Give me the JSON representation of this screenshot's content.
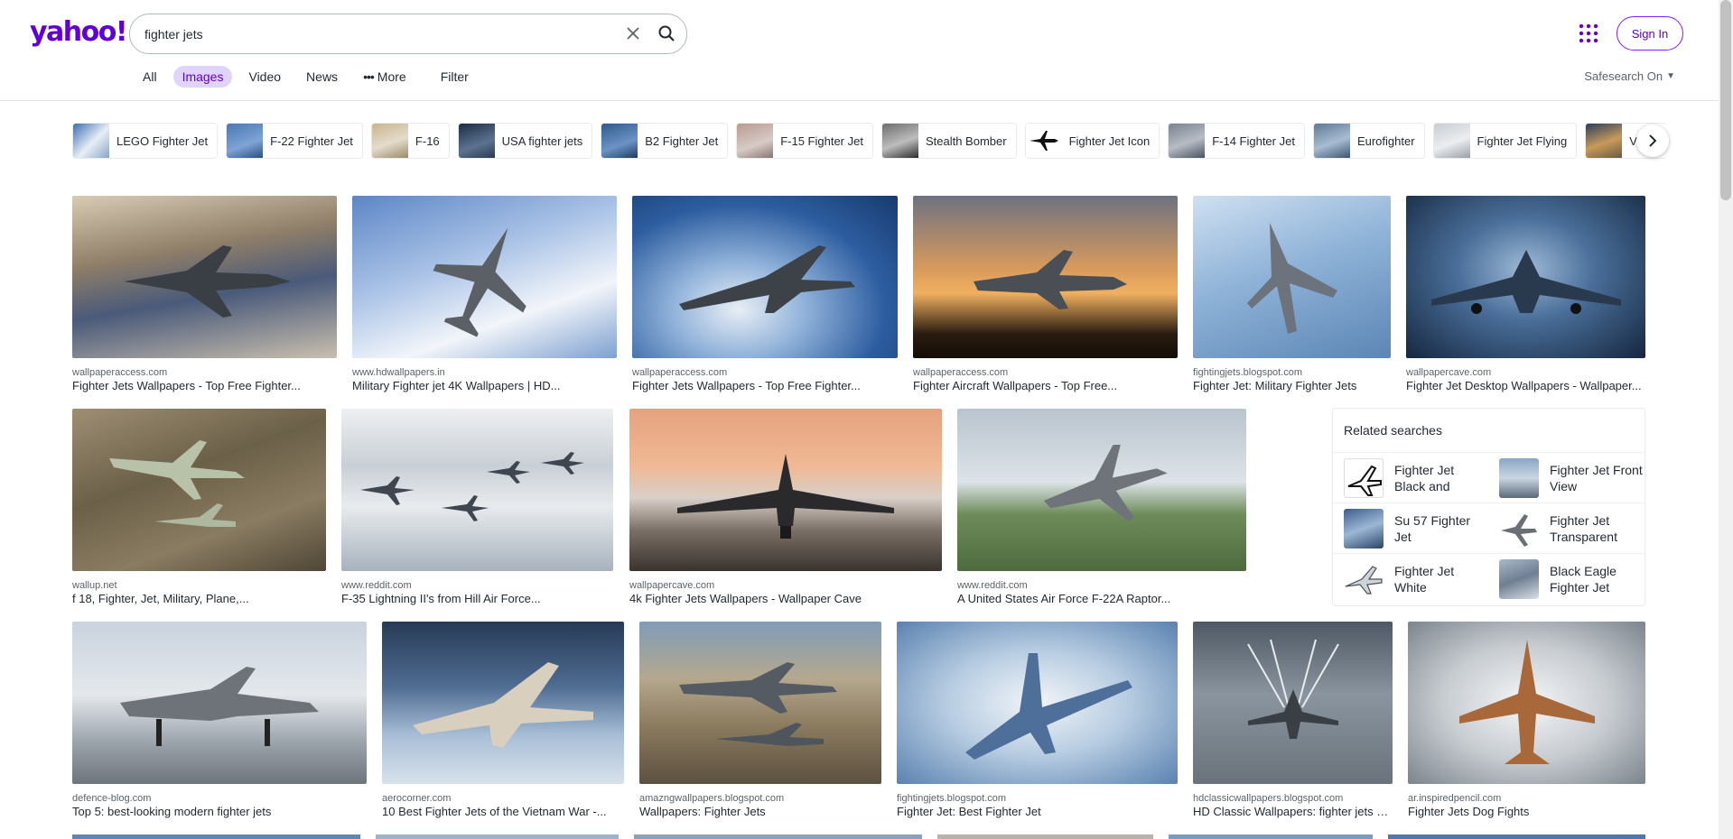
{
  "header": {
    "logo": "yahoo!",
    "search_value": "fighter jets",
    "sign_in": "Sign In",
    "safesearch": "Safesearch On",
    "tabs": [
      {
        "label": "All"
      },
      {
        "label": "Images"
      },
      {
        "label": "Video"
      },
      {
        "label": "News"
      },
      {
        "label": "More"
      },
      {
        "label": "Filter"
      }
    ],
    "active_tab": "Images"
  },
  "pills": [
    {
      "label": "LEGO Fighter Jet"
    },
    {
      "label": "F-22 Fighter Jet"
    },
    {
      "label": "F-16"
    },
    {
      "label": "USA fighter jets"
    },
    {
      "label": "B2 Fighter Jet"
    },
    {
      "label": "F-15 Fighter Jet"
    },
    {
      "label": "Stealth Bomber"
    },
    {
      "label": "Fighter Jet Icon"
    },
    {
      "label": "F-14 Fighter Jet"
    },
    {
      "label": "Eurofighter"
    },
    {
      "label": "Fighter Jet Flying"
    },
    {
      "label": "Vietnam"
    }
  ],
  "results": [
    {
      "source": "wallpaperaccess.com",
      "title": "Fighter Jets Wallpapers - Top Free Fighter..."
    },
    {
      "source": "www.hdwallpapers.in",
      "title": "Military Fighter jet 4K Wallpapers | HD..."
    },
    {
      "source": "wallpaperaccess.com",
      "title": "Fighter Jets Wallpapers - Top Free Fighter..."
    },
    {
      "source": "wallpaperaccess.com",
      "title": "Fighter Aircraft Wallpapers - Top Free..."
    },
    {
      "source": "fightingjets.blogspot.com",
      "title": "Fighter Jet: Military Fighter Jets"
    },
    {
      "source": "wallpapercave.com",
      "title": "Fighter Jet Desktop Wallpapers - Wallpaper..."
    },
    {
      "source": "wallup.net",
      "title": "f 18, Fighter, Jet, Military, Plane,..."
    },
    {
      "source": "www.reddit.com",
      "title": "F-35 Lightning II's from Hill Air Force..."
    },
    {
      "source": "wallpapercave.com",
      "title": "4k Fighter Jets Wallpapers - Wallpaper Cave"
    },
    {
      "source": "www.reddit.com",
      "title": "A United States Air Force F-22A Raptor..."
    },
    {
      "source": "defence-blog.com",
      "title": "Top 5: best-looking modern fighter jets"
    },
    {
      "source": "aerocorner.com",
      "title": "10 Best Fighter Jets of the Vietnam War -..."
    },
    {
      "source": "amazngwallpapers.blogspot.com",
      "title": "Wallpapers: Fighter Jets"
    },
    {
      "source": "fightingjets.blogspot.com",
      "title": "Fighter Jet: Best Fighter Jet"
    },
    {
      "source": "hdclassicwallpapers.blogspot.com",
      "title": "HD Classic Wallpapers: fighter jets p..."
    },
    {
      "source": "ar.inspiredpencil.com",
      "title": "Fighter Jets Dog Fights"
    }
  ],
  "related": {
    "heading": "Related searches",
    "items": [
      {
        "label": "Fighter Jet Black and"
      },
      {
        "label": "Fighter Jet Front View"
      },
      {
        "label": "Su 57 Fighter Jet"
      },
      {
        "label": "Fighter Jet Transparent"
      },
      {
        "label": "Fighter Jet White"
      },
      {
        "label": "Black Eagle Fighter Jet"
      }
    ]
  },
  "colors": {
    "brand": "#6001d2",
    "active_tab_bg": "#e0d4ff"
  },
  "icons": {
    "search": "search-icon",
    "clear": "close-icon",
    "apps": "apps-grid-icon",
    "next": "chevron-right-icon",
    "more": "more-dots-icon"
  }
}
